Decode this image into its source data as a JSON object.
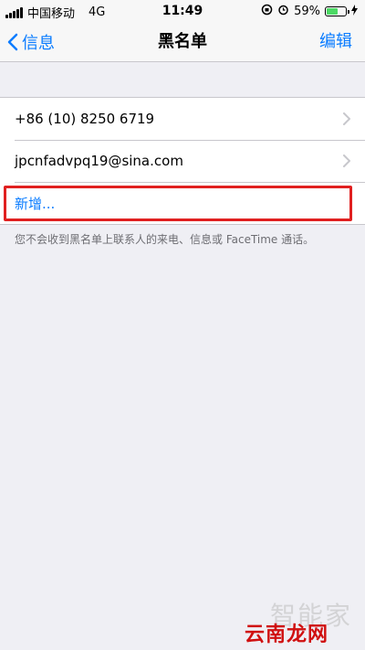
{
  "status_bar": {
    "carrier": "中国移动",
    "network": "4G",
    "time": "11:49",
    "battery_percent": "59%",
    "battery_level": 0.59
  },
  "nav": {
    "back_label": "信息",
    "title": "黑名单",
    "edit_label": "编辑"
  },
  "blocked": [
    {
      "label": "+86 (10) 8250 6719"
    },
    {
      "label": "jpcnfadvpq19@sina.com"
    }
  ],
  "add_label": "新增...",
  "footnote": "您不会收到黑名单上联系人的来电、信息或 FaceTime 通话。",
  "watermark": {
    "text": "智能家",
    "logo": "云南龙网"
  },
  "colors": {
    "accent": "#0a7cff",
    "highlight": "#e02020",
    "battery": "#4cd964"
  }
}
